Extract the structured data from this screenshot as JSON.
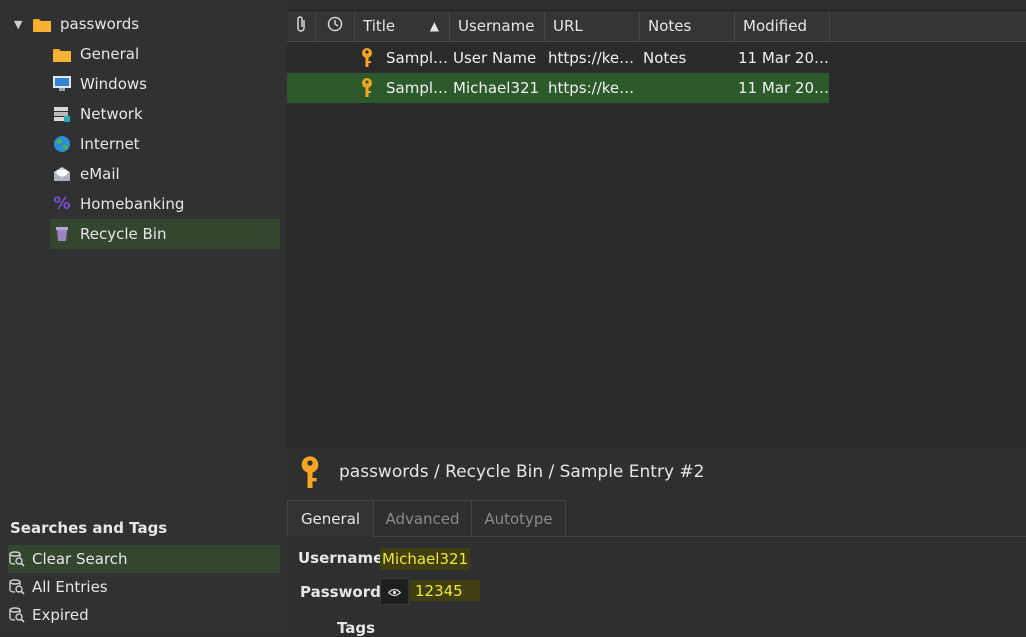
{
  "tree": {
    "root": "passwords",
    "groups": [
      {
        "label": "General",
        "icon": "folder-icon"
      },
      {
        "label": "Windows",
        "icon": "windows-icon"
      },
      {
        "label": "Network",
        "icon": "network-icon"
      },
      {
        "label": "Internet",
        "icon": "globe-icon"
      },
      {
        "label": "eMail",
        "icon": "mail-icon"
      },
      {
        "label": "Homebanking",
        "icon": "percent-icon"
      },
      {
        "label": "Recycle Bin",
        "icon": "trash-icon"
      }
    ]
  },
  "tags": {
    "title": "Searches and Tags",
    "items": [
      "Clear Search",
      "All Entries",
      "Expired"
    ]
  },
  "table": {
    "headers": [
      "Title",
      "Username",
      "URL",
      "Notes",
      "Modified"
    ],
    "rows": [
      {
        "title": "Sampl…",
        "username": "User Name",
        "url": "https://ke…",
        "notes": "Notes",
        "modified": "11 Mar 20…"
      },
      {
        "title": "Sampl…",
        "username": "Michael321",
        "url": "https://ke…",
        "notes": "",
        "modified": "11 Mar 20…"
      }
    ]
  },
  "detail": {
    "breadcrumb": "passwords / Recycle Bin / Sample Entry #2",
    "tabs": [
      "General",
      "Advanced",
      "Autotype"
    ],
    "username_label": "Username",
    "username_value": "Michael321",
    "password_label": "Password",
    "password_value": "12345",
    "tags_label": "Tags"
  },
  "colors": {
    "selection": "#2d5a2a",
    "highlight_text": "#f1e63a",
    "key_icon": "#f6a623",
    "folder": "#f5a623"
  }
}
